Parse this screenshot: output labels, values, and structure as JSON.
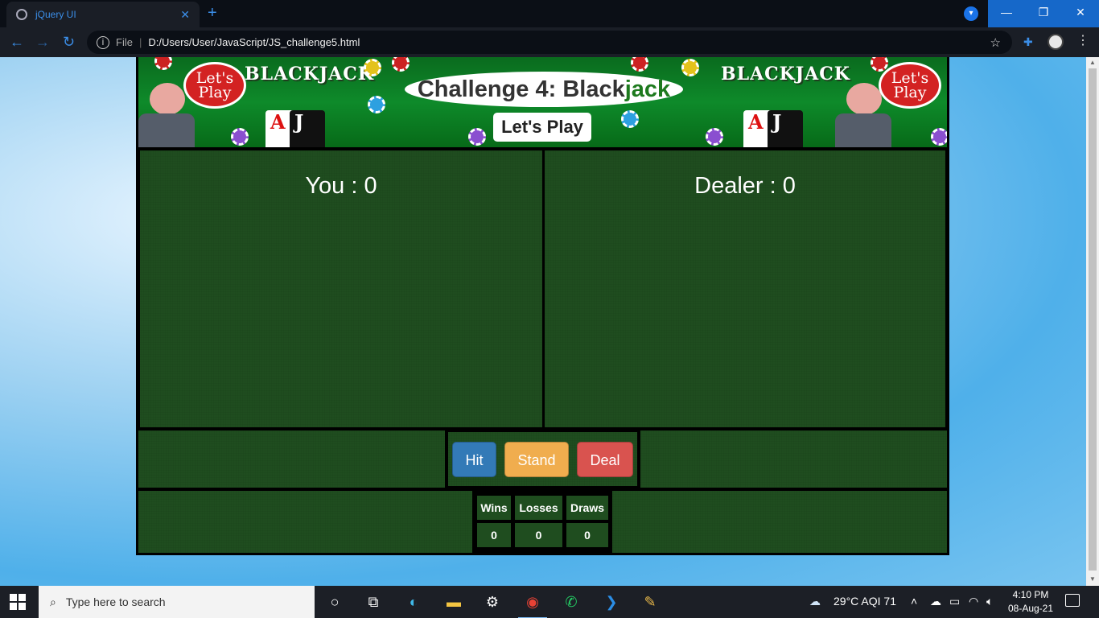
{
  "browser": {
    "tab_title": "jQuery UI",
    "tab_close": "✕",
    "new_tab": "+",
    "address_file_label": "File",
    "address_url": "D:/Users/User/JavaScript/JS_challenge5.html"
  },
  "banner": {
    "brand_text": "BLACKJACK",
    "bubble_text": "Let's Play",
    "card_a": "A",
    "card_j": "J"
  },
  "heading": {
    "prefix": "Challenge 4: Black",
    "accent": "jack",
    "accent_color": "#1e7a1e"
  },
  "lets_play_button": "Let's Play",
  "player": {
    "label": "You : 0"
  },
  "dealer": {
    "label": "Dealer : 0"
  },
  "buttons": {
    "hit": "Hit",
    "stand": "Stand",
    "deal": "Deal",
    "hit_color": "#337ab7",
    "stand_color": "#f0ad4e",
    "deal_color": "#d9534f"
  },
  "stats": {
    "headers": [
      "Wins",
      "Losses",
      "Draws"
    ],
    "values": [
      "0",
      "0",
      "0"
    ]
  },
  "felt_color": "#1f4d1f",
  "taskbar": {
    "search_placeholder": "Type here to search",
    "weather": "29°C  AQI 71",
    "time": "4:10 PM",
    "date": "08-Aug-21",
    "apps": [
      "task-view-icon",
      "edge-icon",
      "file-explorer-icon",
      "settings-icon",
      "chrome-icon",
      "whatsapp-icon",
      "vscode-icon",
      "paint-icon"
    ]
  }
}
